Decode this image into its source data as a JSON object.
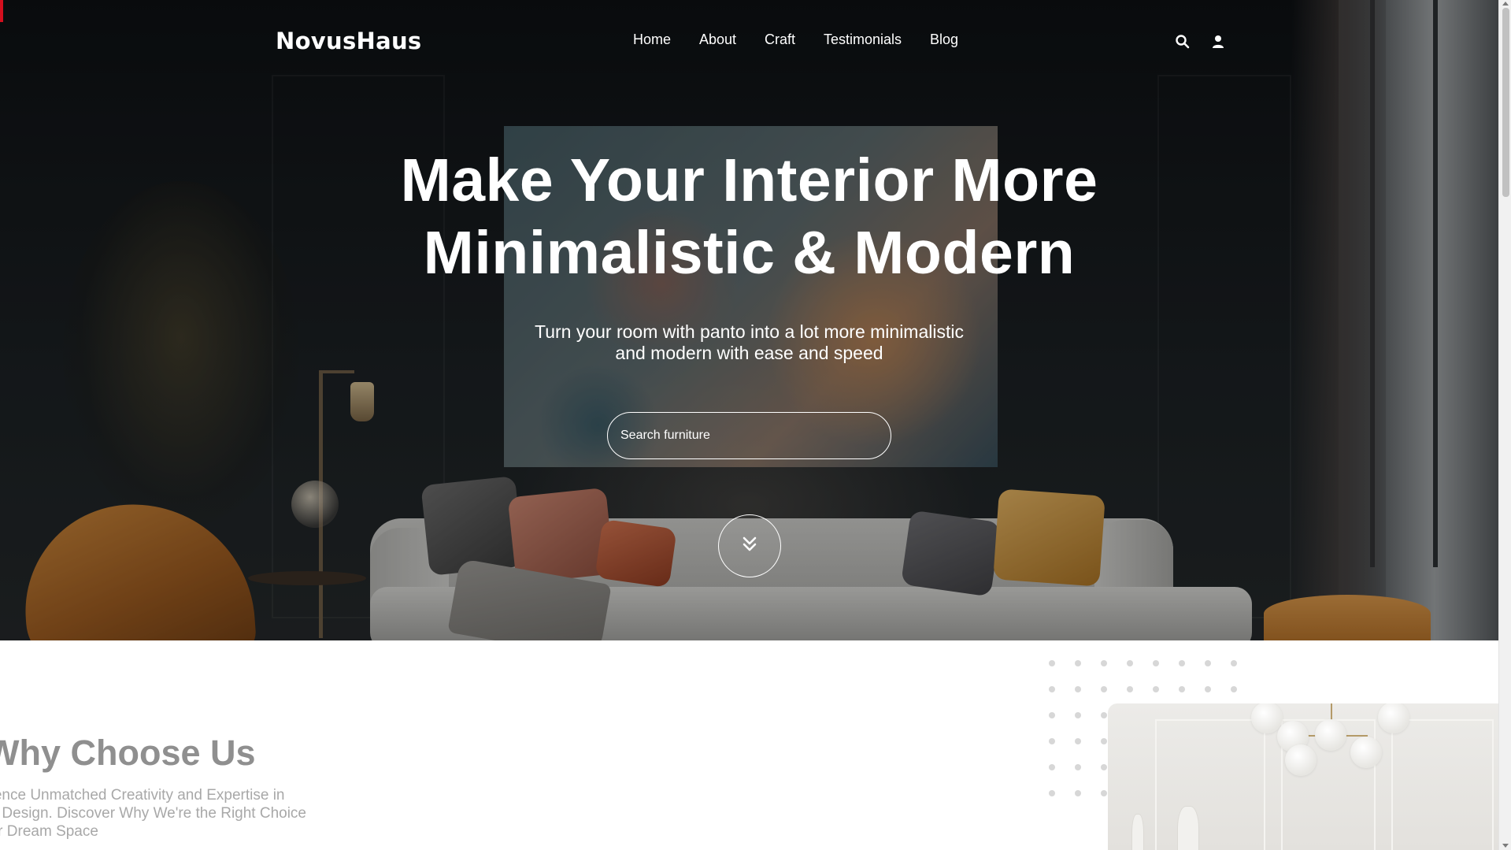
{
  "brand": {
    "name": "NovusHaus"
  },
  "nav": {
    "items": [
      {
        "label": "Home"
      },
      {
        "label": "About"
      },
      {
        "label": "Craft"
      },
      {
        "label": "Testimonials"
      },
      {
        "label": "Blog"
      }
    ],
    "icons": [
      "search-icon",
      "user-icon"
    ]
  },
  "hero": {
    "headline_line1": "Make Your Interior More",
    "headline_line2": "Minimalistic & Modern",
    "subline_line1": "Turn your room with panto into a lot more minimalistic",
    "subline_line2": "and modern with ease and speed",
    "search": {
      "placeholder": "Search furniture",
      "value": ""
    },
    "scroll_icon": "double-chevron-down-icon"
  },
  "why": {
    "title": "Why Choose Us",
    "text_line1": "Experience Unmatched Creativity and Expertise in",
    "text_line2": "Interior Design. Discover Why We're the Right Choice",
    "text_line3": "for Your Dream Space"
  },
  "colors": {
    "text_on_hero": "#ffffff",
    "section_title": "#8f8f8f",
    "section_text": "#a8a8a8",
    "dot_pattern": "#d7d7d7",
    "accent_marker": "#d40f1e"
  }
}
